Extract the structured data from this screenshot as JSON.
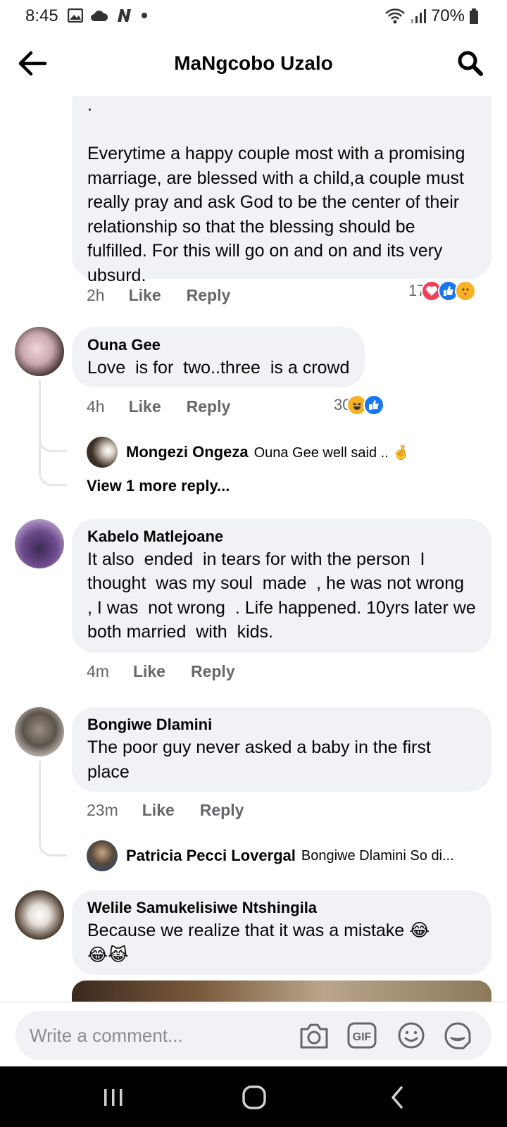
{
  "status_bar": {
    "time": "8:45",
    "battery": "70%"
  },
  "header": {
    "title": "MaNgcobo Uzalo"
  },
  "comments": [
    {
      "text": ".\n\nEverytime a happy couple most with a promising marriage, are blessed with a child,a couple must really pray and ask God to be the center of their relationship so that the blessing should be fulfilled. For this will go on and on and its very ubsurd.",
      "time": "2h",
      "like": "Like",
      "reply": "Reply",
      "reaction_count": "17"
    },
    {
      "author": "Ouna Gee",
      "text": "Love  is for  two..three  is a crowd",
      "time": "4h",
      "like": "Like",
      "reply": "Reply",
      "reaction_count": "30",
      "replies": [
        {
          "author": "Mongezi Ongeza",
          "text": "Ouna Gee well said .. 🤞"
        }
      ],
      "view_more": "View 1 more reply..."
    },
    {
      "author": "Kabelo Matlejoane",
      "text": "It also  ended  in tears for with the person  I thought  was my soul  made  , he was not wrong  , I was  not wrong  . Life happened. 10yrs later we both married  with  kids.",
      "time": "4m",
      "like": "Like",
      "reply": "Reply"
    },
    {
      "author": "Bongiwe Dlamini",
      "text": "The poor guy never asked a baby in the first place",
      "time": "23m",
      "like": "Like",
      "reply": "Reply",
      "replies": [
        {
          "author": "Patricia Pecci Lovergal",
          "text": "Bongiwe Dlamini So di..."
        }
      ]
    },
    {
      "author": "Welile Samukelisiwe Ntshingila",
      "text": "Because we realize that it was a mistake 😂\n😂😹"
    }
  ],
  "composer": {
    "placeholder": "Write a comment..."
  },
  "colors": {
    "bubble": "#f0f2f5",
    "meta": "#65676b",
    "like_blue": "#1877f2",
    "love_red": "#f33e58",
    "haha_yellow": "#f7b125"
  },
  "icons": [
    "back-arrow-icon",
    "search-icon",
    "camera-icon",
    "gif-icon",
    "emoji-icon",
    "sticker-icon",
    "recents-icon",
    "home-icon",
    "nav-back-icon"
  ]
}
